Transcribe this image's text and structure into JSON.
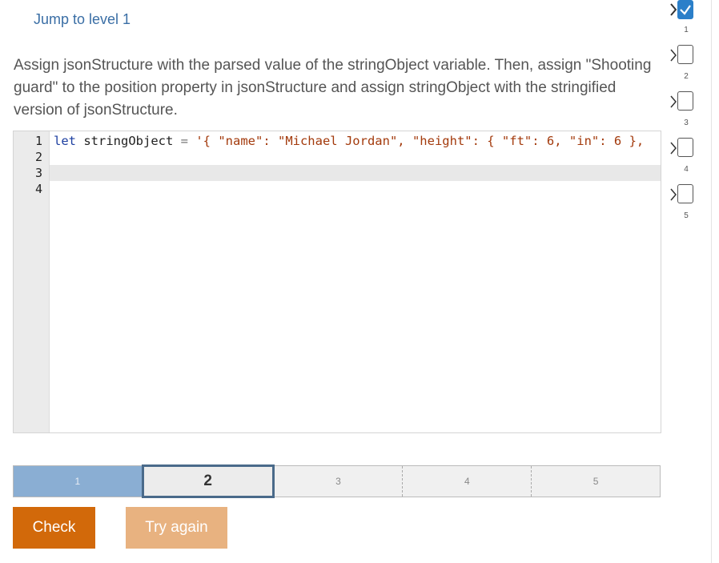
{
  "header": {
    "jump_link": "Jump to level 1"
  },
  "instructions": "Assign jsonStructure with the parsed value of the stringObject variable. Then, assign \"Shooting guard\" to the position property in jsonStructure and assign stringObject with the stringified version of jsonStructure.",
  "editor": {
    "line_numbers": [
      "1",
      "2",
      "3",
      "4"
    ],
    "line1": {
      "keyword": "let",
      "identifier": " stringObject ",
      "operator": "=",
      "string": " '{ \"name\": \"Michael Jordan\", \"height\": { \"ft\": 6, \"in\": 6 },"
    }
  },
  "progress": {
    "segments": [
      "1",
      "2",
      "3",
      "4",
      "5"
    ],
    "current": 2
  },
  "buttons": {
    "check": "Check",
    "try_again": "Try again"
  },
  "sidebar": {
    "levels": [
      "1",
      "2",
      "3",
      "4",
      "5"
    ]
  },
  "colors": {
    "accent": "#2b7fc9",
    "check_button": "#d2690a",
    "try_again_button": "#e8b280",
    "progress_done": "#8aaed3"
  }
}
